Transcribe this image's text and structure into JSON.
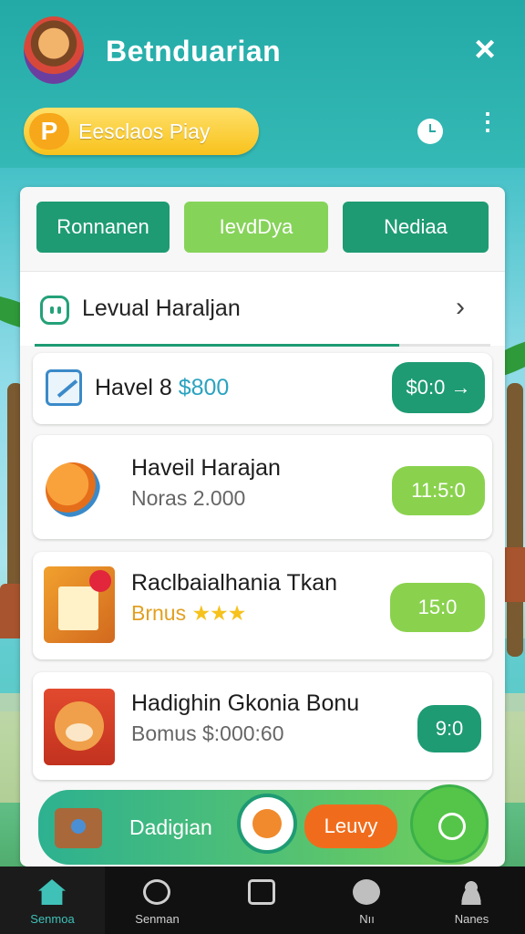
{
  "header": {
    "app_title": "Betnduarian",
    "close_icon": "×",
    "play_pill": {
      "badge": "P",
      "label": "Eesclaos Piay"
    },
    "clock_icon": "clock-icon",
    "more_icon": "⋮"
  },
  "tabs": [
    "Ronnanen",
    "IevdDya",
    "Nediaa"
  ],
  "level_row": {
    "label": "Levual Haraljan",
    "chevron": "›",
    "progress": 0.8
  },
  "items": [
    {
      "title_prefix": "Havel 8",
      "title_price": "$800",
      "button": "$0:0 →"
    },
    {
      "title": "Haveil Harajan",
      "subtitle": "Noras 2.000",
      "button": "11:5:0"
    },
    {
      "title": "Raclbaialhania Tkan",
      "subtitle": "Brnus",
      "stars": "★★★",
      "button": "15:0"
    },
    {
      "title": "Hadighin Gkonia Bonu",
      "subtitle": "Bomus $:000:60",
      "button": "9:0"
    }
  ],
  "banner": {
    "label": "Dadigian",
    "button": "Leuvy"
  },
  "nav": [
    {
      "label": "Senmoa",
      "icon": "home-icon",
      "active": true
    },
    {
      "label": "Senman",
      "icon": "search-icon",
      "active": false
    },
    {
      "label": "",
      "icon": "box-icon",
      "active": false
    },
    {
      "label": "Nıı",
      "icon": "chat-icon",
      "active": false
    },
    {
      "label": "Nanes",
      "icon": "user-icon",
      "active": false
    }
  ],
  "colors": {
    "primary": "#1e9b73",
    "accent": "#8ad24e",
    "header": "#2aaca8",
    "pill": "#f8c21c"
  }
}
